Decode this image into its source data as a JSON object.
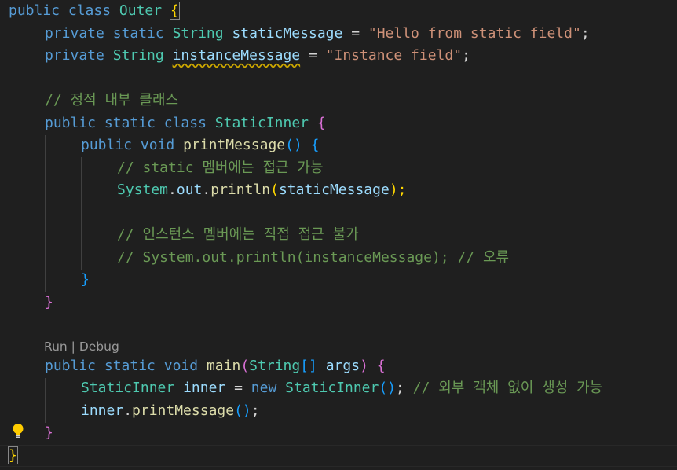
{
  "code": {
    "l1": [
      "public",
      "class",
      "Outer",
      "{"
    ],
    "l2": [
      "private",
      "static",
      "String",
      "staticMessage",
      "=",
      "\"Hello from static field\"",
      ";"
    ],
    "l3": [
      "private",
      "String",
      "instanceMessage",
      "=",
      "\"Instance field\"",
      ";"
    ],
    "l5": "// 정적 내부 클래스",
    "l6": [
      "public",
      "static",
      "class",
      "StaticInner",
      "{"
    ],
    "l7": [
      "public",
      "void",
      "printMessage",
      "(",
      ")",
      "{"
    ],
    "l8": "// static 멤버에는 접근 가능",
    "l9": [
      "System",
      ".",
      "out",
      ".",
      "println",
      "(",
      "staticMessage",
      ");"
    ],
    "l11": "// 인스턴스 멤버에는 직접 접근 불가",
    "l12": "// System.out.println(instanceMessage); // 오류",
    "l13": "}",
    "l14": "}",
    "l16": [
      "public",
      "static",
      "void",
      "main",
      "(",
      "String",
      "[]",
      "args",
      ")",
      "{"
    ],
    "l17": [
      "StaticInner",
      "inner",
      "=",
      "new",
      "StaticInner",
      "(",
      ")",
      ";",
      "// 외부 객체 없이 생성 가능"
    ],
    "l18": [
      "inner",
      ".",
      "printMessage",
      "(",
      ")",
      ";"
    ],
    "l19": "}",
    "l20": "}"
  },
  "codelens": {
    "run": "Run",
    "sep": " | ",
    "debug": "Debug"
  },
  "icons": {
    "lightbulb": "lightbulb-icon"
  },
  "colors": {
    "background": "#1f1f1f",
    "keyword": "#569cd6",
    "type": "#4ec9b0",
    "function": "#dcdcaa",
    "variable": "#9cdcfe",
    "string": "#ce9178",
    "comment": "#6a9955",
    "bracket1": "#ffd700",
    "bracket2": "#da70d6",
    "bracket3": "#179fff"
  }
}
